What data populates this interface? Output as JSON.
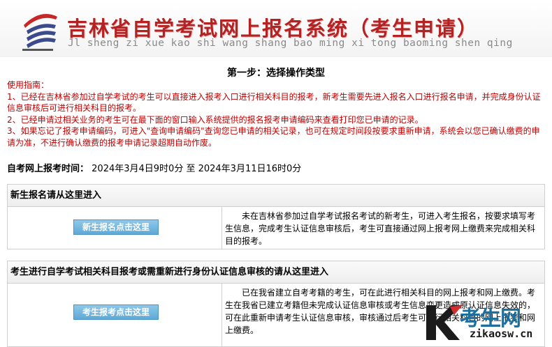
{
  "header": {
    "title": "吉林省自学考试网上报名系统（考生申请）",
    "pinyin": "Jl sheng zi xue kao shi wang shang bao ming xi tong baoming shen qing"
  },
  "step_title": "第一步：选择操作类型",
  "guide": {
    "heading": "使用指南：",
    "items": [
      "1、已经在吉林省参加过自学考试的考生可以直接进入报考入口进行相关科目的报考，新考生需要先进入报名入口进行报名申请，并完成身份认证信息审核后可进行相关科目的报考。",
      "2、已经申请过相关业务的考生可在最下面的窗口输入系统提供的报名报考申请编码来查看打印您已申请的记录。",
      "3、如果忘记了报考申请编码，可进入\"查询申请编码\"查询您已申请的相关记录，也可在规定时间段按要求重新申请，系统会以您已确认缴费的申请为准，不进行确认缴费的报考申请记录超期自动作废。"
    ]
  },
  "exam_time": {
    "label": "自考网上报考时间：",
    "value": "2024年3月4日9时0分 至 2024年3月11日16时0分"
  },
  "sections": [
    {
      "title": "新生报名请从这里进入",
      "button": "新生报名点击这里",
      "description": "未在吉林省参加过自学考试报名考试的新考生，可进入考生报名，按要求填写考生信息，完成考生认证信息审核后，考生可直接通过网上报考网上缴费来完成相关科目的报考。"
    },
    {
      "title": "考生进行自学考试相关科目报考或需重新进行身份认证信息审核的请从这里进入",
      "button": "考生报考点击这里",
      "description": "已在我省建立自考考籍的考生，可在此进行相关科目的网上报考和网上缴费。考生在我省已建立考籍但未完成认证信息审核或考生信息变更造成原认证信息失效的，可在此重新申请考生认证信息审核，审核通过后考生可进行相关科目的网上报考和网上缴费。"
    }
  ],
  "watermark": {
    "cn": "考生网",
    "url": "zikaosw.cn"
  },
  "colors": {
    "title_red": "#b32323",
    "guide_red": "#c00000",
    "button_blue": "#5ea9d6"
  }
}
